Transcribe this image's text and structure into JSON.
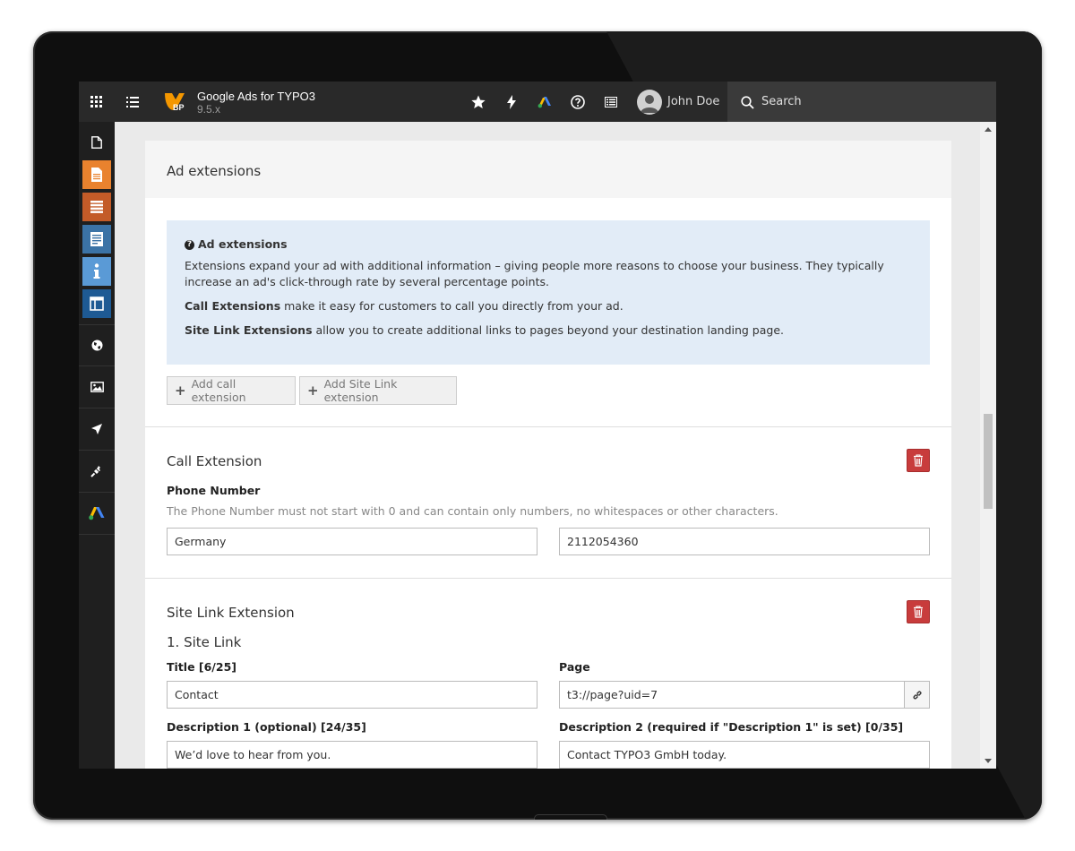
{
  "topbar": {
    "site_title": "Google Ads for TYPO3",
    "site_version": "9.5.x",
    "logo_badge": "BP",
    "user_name": "John Doe",
    "search_label": "Search",
    "icons": [
      "module-menu-icon",
      "page-tree-icon",
      "star-icon",
      "flash-icon",
      "google-ads-icon",
      "help-icon",
      "list-icon",
      "avatar-icon",
      "search-icon"
    ]
  },
  "modules": [
    {
      "name": "page-icon",
      "color": "#1f1f1f"
    },
    {
      "name": "page-module-icon",
      "color": "#e9822e"
    },
    {
      "name": "list-module-icon",
      "color": "#c35b28"
    },
    {
      "name": "view-module-icon",
      "color": "#3b73a6"
    },
    {
      "name": "info-module-icon",
      "color": "#5a9ad6"
    },
    {
      "name": "template-module-icon",
      "color": "#1e5a94"
    },
    {
      "name": "globe-icon"
    },
    {
      "name": "image-icon"
    },
    {
      "name": "rocket-icon"
    },
    {
      "name": "plug-icon"
    },
    {
      "name": "google-ads-module-icon"
    }
  ],
  "panel": {
    "title": "Ad extensions",
    "info": {
      "title": "Ad extensions",
      "p1": "Extensions expand your ad with additional information – giving people more reasons to choose your business. They typically increase an ad's click-through rate by several percentage points.",
      "p2_bold": "Call Extensions",
      "p2_rest": " make it easy for customers to call you directly from your ad.",
      "p3_bold": "Site Link Extensions",
      "p3_rest": " allow you to create additional links to pages beyond your destination landing page."
    },
    "buttons": {
      "add_call": "Add call extension",
      "add_sitelink": "Add Site Link extension"
    }
  },
  "call_extension": {
    "title": "Call Extension",
    "phone_label": "Phone Number",
    "phone_help": "The Phone Number must not start with 0 and can contain only numbers, no whitespaces or other characters.",
    "country_value": "Germany",
    "number_value": "2112054360"
  },
  "site_link_extension": {
    "title": "Site Link Extension",
    "sub_title": "1. Site Link",
    "title_label": "Title [6/25]",
    "title_value": "Contact",
    "page_label": "Page",
    "page_value": "t3://page?uid=7",
    "desc1_label": "Description 1 (optional) [24/35]",
    "desc1_value": "We’d love to hear from you.",
    "desc2_label": "Description 2 (required if \"Description 1\" is set) [0/35]",
    "desc2_value": "Contact TYPO3 GmbH today."
  },
  "colors": {
    "topbar": "#292929",
    "info_box": "#e2ecf7",
    "delete": "#c83c3c",
    "typo3_orange": "#f49700"
  }
}
